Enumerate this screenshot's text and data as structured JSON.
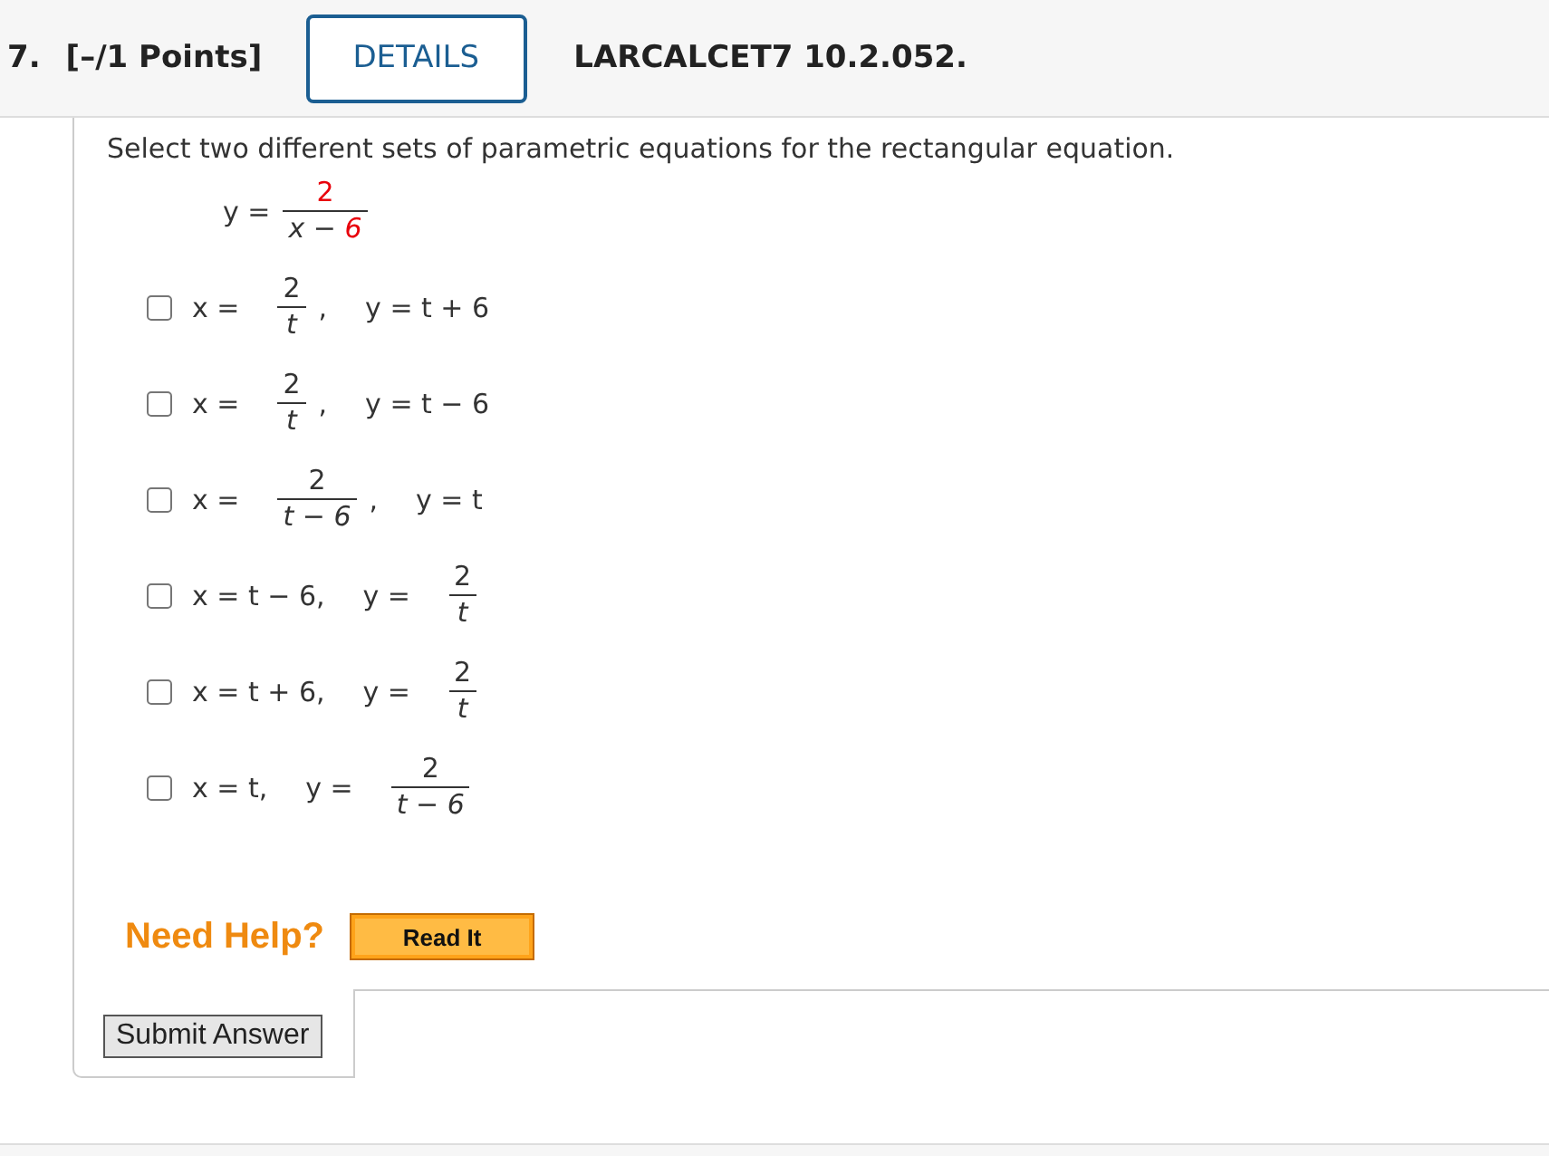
{
  "header": {
    "number": "7.",
    "points": "[–/1 Points]",
    "details_button": "DETAILS",
    "problem_id": "LARCALCET7 10.2.052."
  },
  "prompt": "Select two different sets of parametric equations for the rectangular equation.",
  "equation": [
    {
      "kind": "text",
      "text": "y ="
    },
    {
      "kind": "frac",
      "num": [
        {
          "text": "2",
          "highlight": true
        }
      ],
      "den": [
        {
          "text": "x − ",
          "highlight": false
        },
        {
          "text": "6",
          "highlight": true
        }
      ]
    }
  ],
  "options": [
    {
      "checked": false,
      "parts": [
        {
          "kind": "text",
          "text": "x ="
        },
        {
          "kind": "frac",
          "num": [
            {
              "text": "2",
              "highlight": false
            }
          ],
          "den": [
            {
              "text": "t",
              "highlight": false
            }
          ]
        },
        {
          "kind": "text",
          "text": ","
        },
        {
          "kind": "text",
          "text": "y = t + 6"
        }
      ]
    },
    {
      "checked": false,
      "parts": [
        {
          "kind": "text",
          "text": "x ="
        },
        {
          "kind": "frac",
          "num": [
            {
              "text": "2",
              "highlight": false
            }
          ],
          "den": [
            {
              "text": "t",
              "highlight": false
            }
          ]
        },
        {
          "kind": "text",
          "text": ","
        },
        {
          "kind": "text",
          "text": "y = t − 6"
        }
      ]
    },
    {
      "checked": false,
      "parts": [
        {
          "kind": "text",
          "text": "x ="
        },
        {
          "kind": "frac",
          "num": [
            {
              "text": "2",
              "highlight": false
            }
          ],
          "den": [
            {
              "text": "t − 6",
              "highlight": false
            }
          ]
        },
        {
          "kind": "text",
          "text": ","
        },
        {
          "kind": "text",
          "text": "y = t"
        }
      ]
    },
    {
      "checked": false,
      "parts": [
        {
          "kind": "text",
          "text": "x = t − 6,"
        },
        {
          "kind": "text",
          "text": "y ="
        },
        {
          "kind": "frac",
          "num": [
            {
              "text": "2",
              "highlight": false
            }
          ],
          "den": [
            {
              "text": "t",
              "highlight": false
            }
          ]
        }
      ]
    },
    {
      "checked": false,
      "parts": [
        {
          "kind": "text",
          "text": "x = t + 6,"
        },
        {
          "kind": "text",
          "text": "y ="
        },
        {
          "kind": "frac",
          "num": [
            {
              "text": "2",
              "highlight": false
            }
          ],
          "den": [
            {
              "text": "t",
              "highlight": false
            }
          ]
        }
      ]
    },
    {
      "checked": false,
      "parts": [
        {
          "kind": "text",
          "text": "x = t,"
        },
        {
          "kind": "text",
          "text": "y ="
        },
        {
          "kind": "frac",
          "num": [
            {
              "text": "2",
              "highlight": false
            }
          ],
          "den": [
            {
              "text": "t − 6",
              "highlight": false
            }
          ]
        }
      ]
    }
  ],
  "help": {
    "label": "Need Help?",
    "button": "Read It"
  },
  "submit_button": "Submit Answer"
}
